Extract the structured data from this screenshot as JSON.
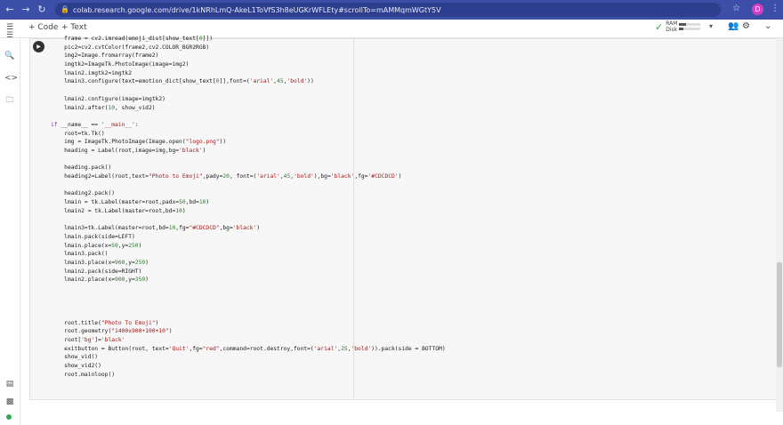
{
  "browser": {
    "url": "colab.research.google.com/drive/1kNRhLmQ-AkeL1ToVfS3h8eUGKrWFLEty#scrollTo=mAMMqmWGtY5V",
    "profile_initial": "D"
  },
  "toolbar": {
    "add_code": "+ Code",
    "add_text": "+ Text",
    "ram_label": "RAM",
    "disk_label": "Disk",
    "ram_level": 0.3,
    "disk_level": 0.2
  },
  "code_lines": [
    "    frame = cv2.imread(emoji_dist[show_text[0]])",
    "    pic2=cv2.cvtColor(frame2,cv2.COLOR_BGR2RGB)",
    "    img2=Image.fromarray(frame2)",
    "    imgtk2=ImageTk.PhotoImage(image=img2)",
    "    lmain2.imgtk2=imgtk2",
    "    lmain3.configure(text=emotion_dict[show_text[0]],font=('arial',45,'bold'))",
    "",
    "    lmain2.configure(image=imgtk2)",
    "    lmain2.after(10, show_vid2)",
    "",
    "if __name__ == '__main__':",
    "    root=tk.Tk()",
    "    img = ImageTk.PhotoImage(Image.open(\"logo.png\"))",
    "    heading = Label(root,image=img,bg='black')",
    "",
    "    heading.pack()",
    "    heading2=Label(root,text=\"Photo to Emoji\",pady=20, font=('arial',45,'bold'),bg='black',fg='#CDCDCD')",
    "",
    "    heading2.pack()",
    "    lmain = tk.Label(master=root,padx=50,bd=10)",
    "    lmain2 = tk.Label(master=root,bd=10)",
    "",
    "    lmain3=tk.Label(master=root,bd=10,fg=\"#CDCDCD\",bg='black')",
    "    lmain.pack(side=LEFT)",
    "    lmain.place(x=50,y=250)",
    "    lmain3.pack()",
    "    lmain3.place(x=960,y=250)",
    "    lmain2.pack(side=RIGHT)",
    "    lmain2.place(x=900,y=350)",
    "",
    "",
    "",
    "",
    "    root.title(\"Photo To Emoji\")",
    "    root.geometry(\"1400x900+100+10\")",
    "    root['bg']='black'",
    "    exitbutton = Button(root, text='Quit',fg=\"red\",command=root.destroy,font=('arial',25,'bold')).pack(side = BOTTOM)",
    "    show_vid()",
    "    show_vid2()",
    "    root.mainloop()"
  ],
  "colors": {
    "chrome": "#3c4fa8",
    "keyword": "#7a37a3",
    "string": "#a31515",
    "number": "#2b7a2b"
  }
}
